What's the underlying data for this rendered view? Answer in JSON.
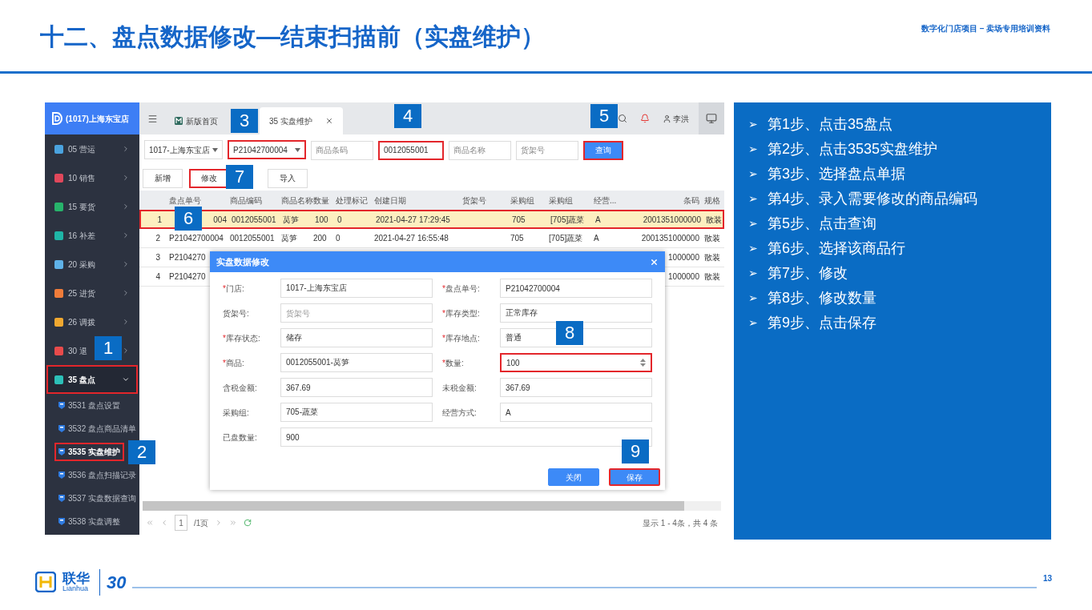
{
  "title": "十二、盘点数据修改—结束扫描前（实盘维护）",
  "header_note": "数字化门店项目 – 卖场专用培训资料",
  "app": {
    "store_name": "(1017)上海东宝店",
    "menu": [
      {
        "label": "05 营运",
        "color": "#4aa3df",
        "expanded": false,
        "highlighted": false
      },
      {
        "label": "10 销售",
        "color": "#e0475b",
        "expanded": false,
        "highlighted": false
      },
      {
        "label": "15 要货",
        "color": "#27b36b",
        "expanded": false,
        "highlighted": false
      },
      {
        "label": "16 补差",
        "color": "#1fb5a7",
        "expanded": false,
        "highlighted": false
      },
      {
        "label": "20 采购",
        "color": "#5fb2e8",
        "expanded": false,
        "highlighted": false
      },
      {
        "label": "25 进货",
        "color": "#f07c3a",
        "expanded": false,
        "highlighted": false
      },
      {
        "label": "26 调拨",
        "color": "#f0a830",
        "expanded": false,
        "highlighted": false
      },
      {
        "label": "30 退",
        "color": "#e84b4b",
        "expanded": false,
        "highlighted": false
      },
      {
        "label": "35 盘点",
        "color": "#2cc0b8",
        "expanded": true,
        "highlighted": true,
        "callout": "1",
        "children": [
          {
            "label": "3531 盘点设置",
            "selected": false,
            "highlighted": false
          },
          {
            "label": "3532 盘点商品清单",
            "selected": false,
            "highlighted": false
          },
          {
            "label": "3535 实盘维护",
            "selected": true,
            "highlighted": true,
            "callout": "2"
          },
          {
            "label": "3536 盘点扫描记录",
            "selected": false,
            "highlighted": false
          },
          {
            "label": "3537 实盘数据查询",
            "selected": false,
            "highlighted": false
          },
          {
            "label": "3538 实盘调整",
            "selected": false,
            "highlighted": false
          }
        ]
      }
    ],
    "tabs": [
      {
        "label": "新版首页",
        "selected": false
      },
      {
        "label": "35 实盘维护",
        "selected": true,
        "callout": "3"
      }
    ],
    "user": "李洪",
    "filters": [
      {
        "kind": "select",
        "value": "1017-上海东宝店",
        "highlighted": false
      },
      {
        "kind": "select",
        "value": "P21042700004",
        "highlighted": true
      },
      {
        "kind": "input",
        "placeholder": "商品条码",
        "highlighted": false
      },
      {
        "kind": "input",
        "value": "0012055001",
        "highlighted": true,
        "callout": "4"
      },
      {
        "kind": "input",
        "placeholder": "商品名称",
        "highlighted": false
      },
      {
        "kind": "input",
        "placeholder": "货架号",
        "highlighted": false
      }
    ],
    "query_button": {
      "label": "查询",
      "highlighted": true,
      "callout": "5"
    },
    "actions": [
      {
        "label": "新增",
        "highlighted": false
      },
      {
        "label": "修改",
        "highlighted": true,
        "callout": "7"
      },
      {
        "label": "导入",
        "highlighted": false
      }
    ],
    "table": {
      "columns": [
        "盘点单号",
        "商品编码",
        "商品名称",
        "数量",
        "处理标记",
        "创建日期",
        "货架号",
        "采购组",
        "采购组",
        "经营...",
        "条码",
        "规格"
      ],
      "rows": [
        {
          "selected": true,
          "highlighted": true,
          "callout": "6",
          "index": "1",
          "cells": [
            "004",
            "0012055001",
            "莴笋",
            "100",
            "0",
            "2021-04-27 17:29:45",
            null,
            "705",
            "[705]蔬菜",
            "A",
            "2001351000000",
            "散装"
          ]
        },
        {
          "selected": false,
          "highlighted": false,
          "index": "2",
          "cells": [
            "P21042700004",
            "0012055001",
            "莴笋",
            "200",
            "0",
            "2021-04-27 16:55:48",
            null,
            "705",
            "[705]蔬菜",
            "A",
            "2001351000000",
            "散装"
          ]
        },
        {
          "selected": false,
          "highlighted": false,
          "index": "3",
          "cells": [
            "P2104270",
            null,
            null,
            null,
            null,
            null,
            null,
            null,
            null,
            null,
            "1000000",
            "散装"
          ]
        },
        {
          "selected": false,
          "highlighted": false,
          "index": "4",
          "cells": [
            "P2104270",
            null,
            null,
            null,
            null,
            null,
            null,
            null,
            null,
            null,
            "1000000",
            "散装"
          ]
        }
      ]
    },
    "pager": {
      "page": "1",
      "total": "/1页",
      "summary": "显示 1 - 4条，共 4 条"
    },
    "modal": {
      "title": "实盘数据修改",
      "required_mark": "*",
      "fields": [
        {
          "label": "门店:",
          "required": true,
          "value": "1017-上海东宝店"
        },
        {
          "label": "盘点单号:",
          "required": true,
          "value": "P21042700004"
        },
        {
          "label": "货架号:",
          "required": false,
          "placeholder": "货架号"
        },
        {
          "label": "库存类型:",
          "required": true,
          "value": "正常库存"
        },
        {
          "label": "库存状态:",
          "required": true,
          "value": "储存"
        },
        {
          "label": "库存地点:",
          "required": true,
          "value": "普通"
        },
        {
          "label": "商品:",
          "required": true,
          "value": "0012055001-莴笋"
        },
        {
          "label": "数量:",
          "required": true,
          "value": "100",
          "kind": "number",
          "highlighted": true,
          "callout": "8"
        },
        {
          "label": "含税金额:",
          "required": false,
          "value": "367.69"
        },
        {
          "label": "未税金额:",
          "required": false,
          "value": "367.69"
        },
        {
          "label": "采购组:",
          "required": false,
          "value": "705-蔬菜"
        },
        {
          "label": "经营方式:",
          "required": false,
          "value": "A"
        },
        {
          "label": "已盘数量:",
          "required": false,
          "value": "900",
          "kind": "wide"
        }
      ],
      "buttons": [
        {
          "label": "关闭",
          "highlighted": false
        },
        {
          "label": "保存",
          "highlighted": true,
          "callout": "9"
        }
      ]
    }
  },
  "steps": [
    {
      "bullet": "➢",
      "text": "第1步、点击35盘点"
    },
    {
      "bullet": "➢",
      "text": "第2步、点击3535实盘维护"
    },
    {
      "bullet": "➢",
      "text": "第3步、选择盘点单据"
    },
    {
      "bullet": "➢",
      "text": "第4步、录入需要修改的商品编码"
    },
    {
      "bullet": "➢",
      "text": "第5步、点击查询"
    },
    {
      "bullet": "➢",
      "text": "第6步、选择该商品行"
    },
    {
      "bullet": "➢",
      "text": "第7步、修改"
    },
    {
      "bullet": "➢",
      "text": "第8步、修改数量"
    },
    {
      "bullet": "➢",
      "text": "第9步、点击保存"
    }
  ],
  "footer": {
    "logo_text": "联华",
    "logo_latin": "Lianhua",
    "anniversary": "30",
    "page_number": "13"
  }
}
